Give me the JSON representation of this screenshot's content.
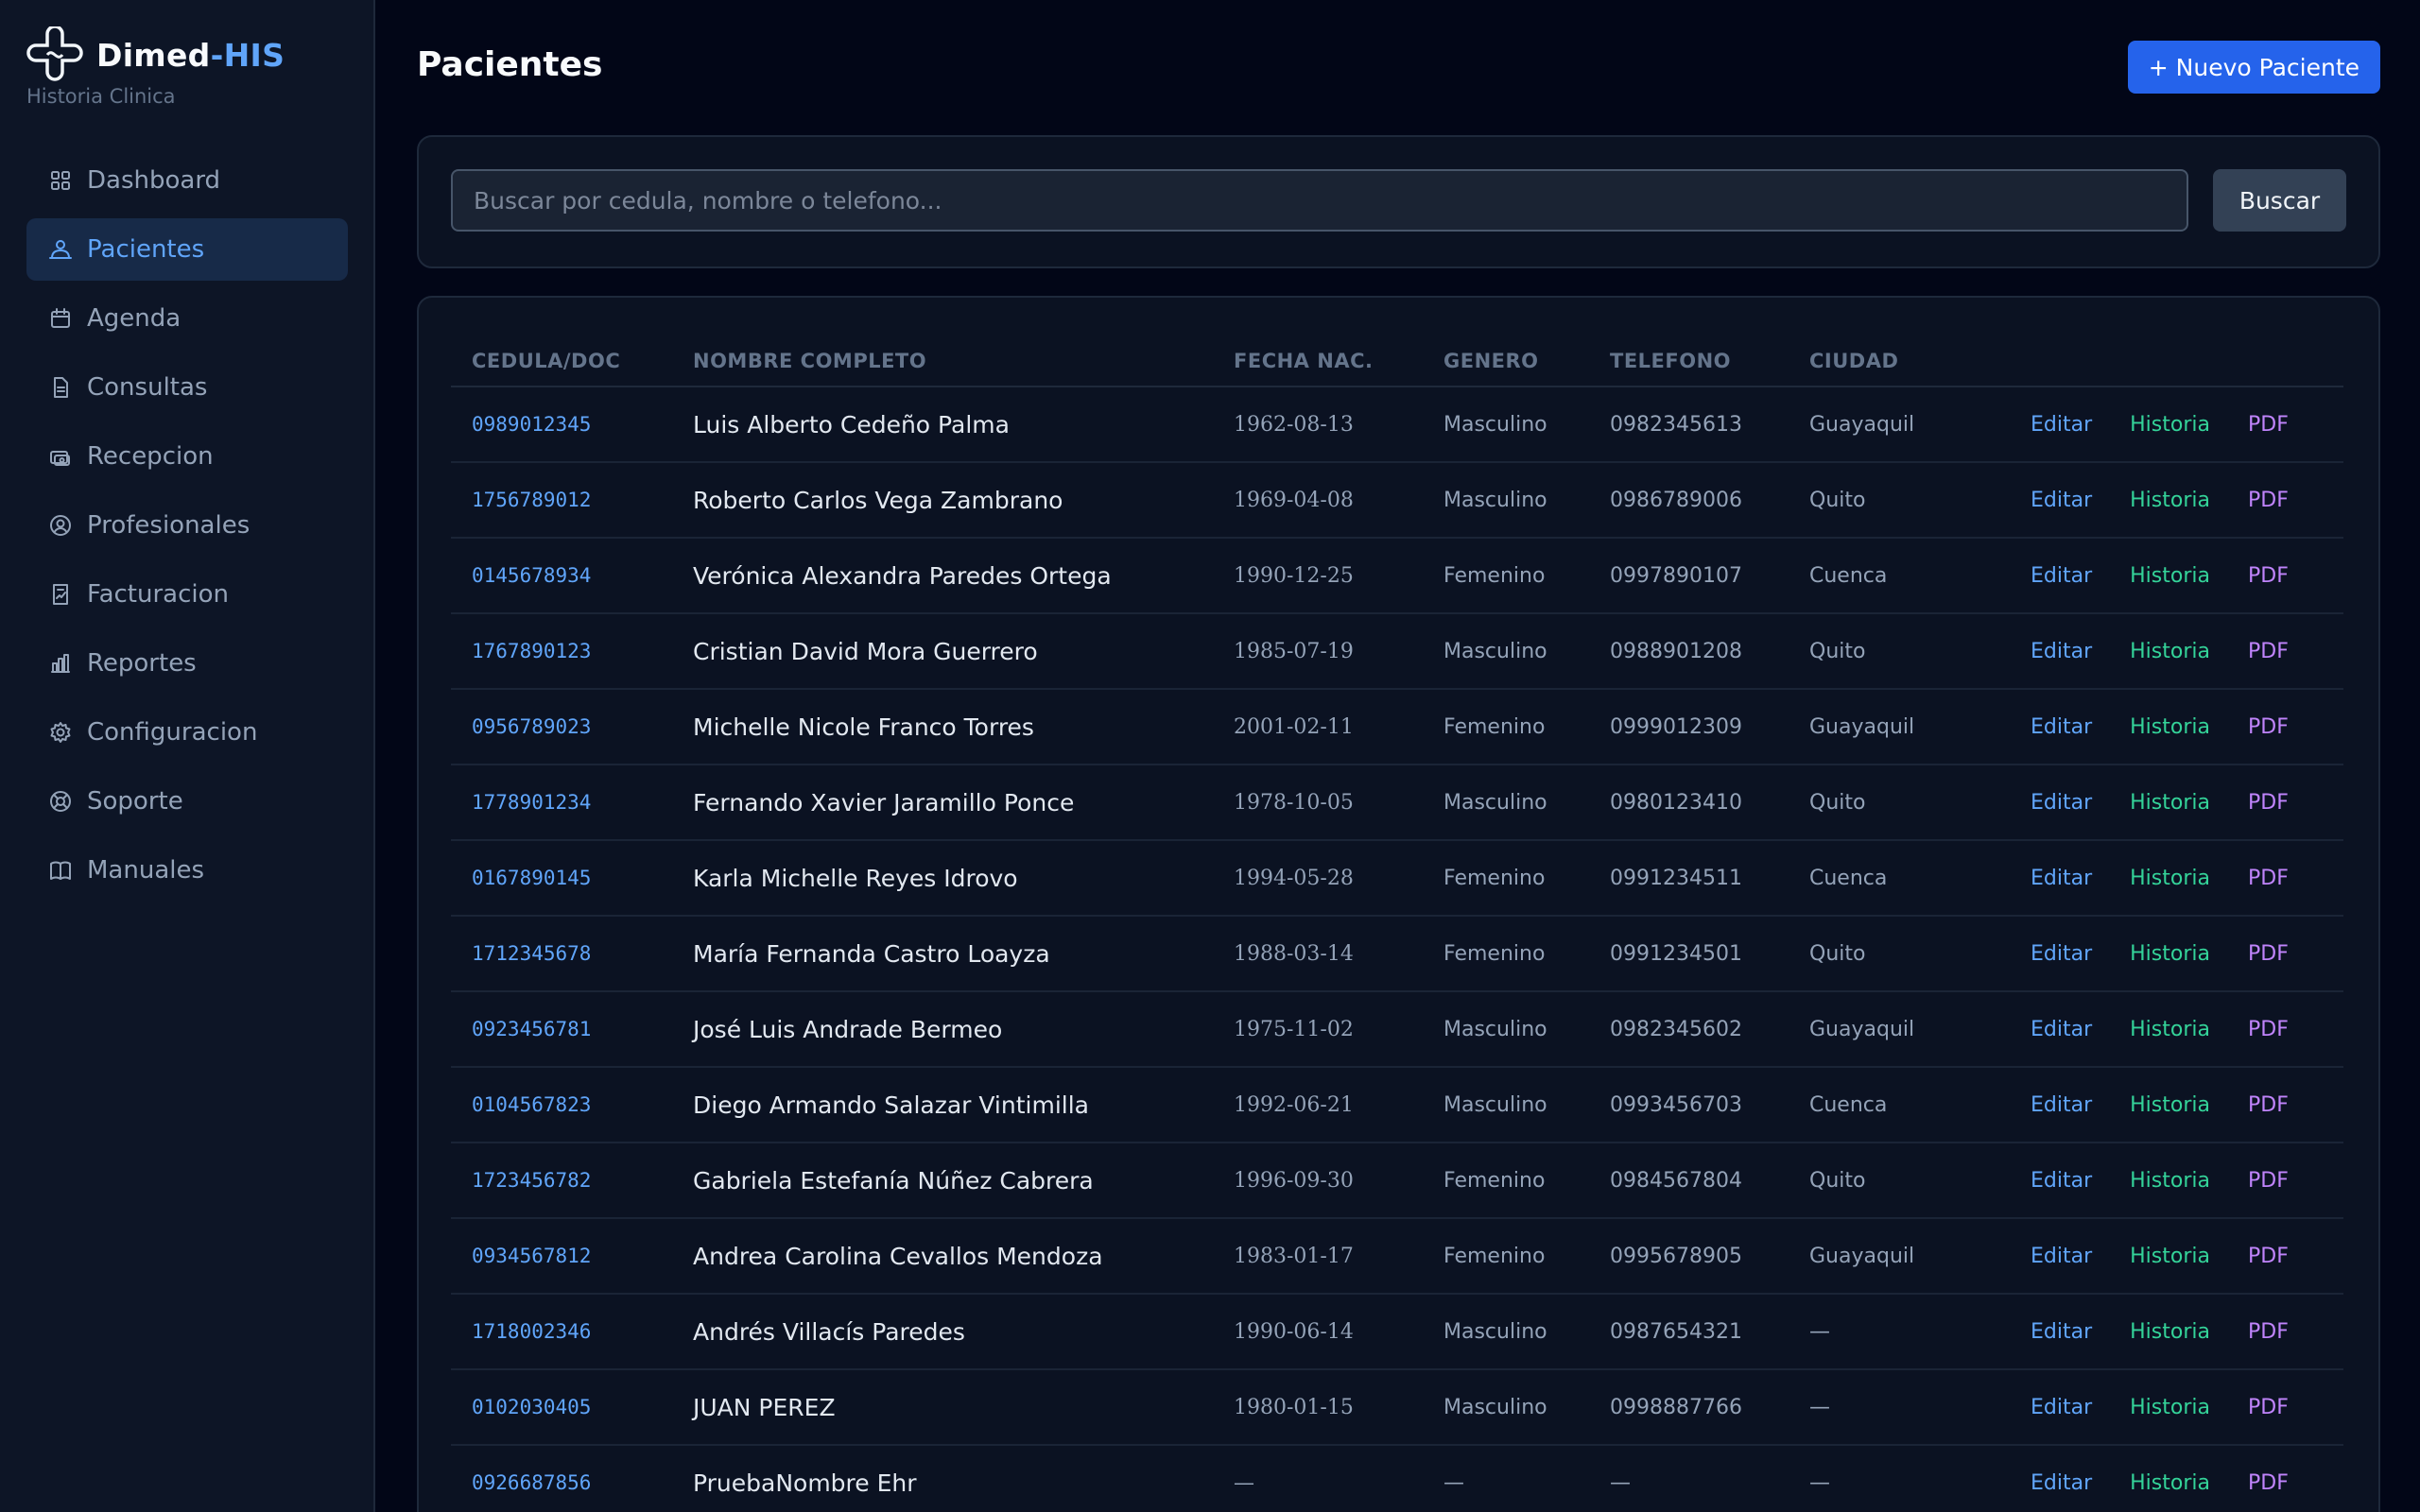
{
  "brand": {
    "name": "Dimed",
    "name_accent": "-HIS",
    "subtitle": "Historia Clinica"
  },
  "sidebar": {
    "items": [
      {
        "label": "Dashboard",
        "icon": "grid-icon",
        "active": false
      },
      {
        "label": "Pacientes",
        "icon": "users-icon",
        "active": true
      },
      {
        "label": "Agenda",
        "icon": "calendar-icon",
        "active": false
      },
      {
        "label": "Consultas",
        "icon": "document-icon",
        "active": false
      },
      {
        "label": "Recepcion",
        "icon": "reception-icon",
        "active": false
      },
      {
        "label": "Profesionales",
        "icon": "user-circle-icon",
        "active": false
      },
      {
        "label": "Facturacion",
        "icon": "invoice-icon",
        "active": false
      },
      {
        "label": "Reportes",
        "icon": "bar-chart-icon",
        "active": false
      },
      {
        "label": "Configuracion",
        "icon": "gear-icon",
        "active": false
      },
      {
        "label": "Soporte",
        "icon": "lifebuoy-icon",
        "active": false
      },
      {
        "label": "Manuales",
        "icon": "book-icon",
        "active": false
      }
    ]
  },
  "header": {
    "title": "Pacientes",
    "new_button": "+ Nuevo Paciente"
  },
  "search": {
    "placeholder": "Buscar por cedula, nombre o telefono...",
    "value": "",
    "button": "Buscar"
  },
  "table": {
    "headers": [
      "CEDULA/DOC",
      "NOMBRE COMPLETO",
      "FECHA NAC.",
      "GENERO",
      "TELEFONO",
      "CIUDAD"
    ],
    "actions": {
      "edit": "Editar",
      "history": "Historia",
      "pdf": "PDF"
    },
    "rows": [
      {
        "cedula": "0989012345",
        "nombre": "Luis Alberto Cedeño Palma",
        "fecha": "1962-08-13",
        "genero": "Masculino",
        "telefono": "0982345613",
        "ciudad": "Guayaquil"
      },
      {
        "cedula": "1756789012",
        "nombre": "Roberto Carlos Vega Zambrano",
        "fecha": "1969-04-08",
        "genero": "Masculino",
        "telefono": "0986789006",
        "ciudad": "Quito"
      },
      {
        "cedula": "0145678934",
        "nombre": "Verónica Alexandra Paredes Ortega",
        "fecha": "1990-12-25",
        "genero": "Femenino",
        "telefono": "0997890107",
        "ciudad": "Cuenca"
      },
      {
        "cedula": "1767890123",
        "nombre": "Cristian David Mora Guerrero",
        "fecha": "1985-07-19",
        "genero": "Masculino",
        "telefono": "0988901208",
        "ciudad": "Quito"
      },
      {
        "cedula": "0956789023",
        "nombre": "Michelle Nicole Franco Torres",
        "fecha": "2001-02-11",
        "genero": "Femenino",
        "telefono": "0999012309",
        "ciudad": "Guayaquil"
      },
      {
        "cedula": "1778901234",
        "nombre": "Fernando Xavier Jaramillo Ponce",
        "fecha": "1978-10-05",
        "genero": "Masculino",
        "telefono": "0980123410",
        "ciudad": "Quito"
      },
      {
        "cedula": "0167890145",
        "nombre": "Karla Michelle Reyes Idrovo",
        "fecha": "1994-05-28",
        "genero": "Femenino",
        "telefono": "0991234511",
        "ciudad": "Cuenca"
      },
      {
        "cedula": "1712345678",
        "nombre": "María Fernanda Castro Loayza",
        "fecha": "1988-03-14",
        "genero": "Femenino",
        "telefono": "0991234501",
        "ciudad": "Quito"
      },
      {
        "cedula": "0923456781",
        "nombre": "José Luis Andrade Bermeo",
        "fecha": "1975-11-02",
        "genero": "Masculino",
        "telefono": "0982345602",
        "ciudad": "Guayaquil"
      },
      {
        "cedula": "0104567823",
        "nombre": "Diego Armando Salazar Vintimilla",
        "fecha": "1992-06-21",
        "genero": "Masculino",
        "telefono": "0993456703",
        "ciudad": "Cuenca"
      },
      {
        "cedula": "1723456782",
        "nombre": "Gabriela Estefanía Núñez Cabrera",
        "fecha": "1996-09-30",
        "genero": "Femenino",
        "telefono": "0984567804",
        "ciudad": "Quito"
      },
      {
        "cedula": "0934567812",
        "nombre": "Andrea Carolina Cevallos Mendoza",
        "fecha": "1983-01-17",
        "genero": "Femenino",
        "telefono": "0995678905",
        "ciudad": "Guayaquil"
      },
      {
        "cedula": "1718002346",
        "nombre": "Andrés Villacís Paredes",
        "fecha": "1990-06-14",
        "genero": "Masculino",
        "telefono": "0987654321",
        "ciudad": "—"
      },
      {
        "cedula": "0102030405",
        "nombre": "JUAN PEREZ",
        "fecha": "1980-01-15",
        "genero": "Masculino",
        "telefono": "0998887766",
        "ciudad": "—"
      },
      {
        "cedula": "0926687856",
        "nombre": "PruebaNombre Ehr",
        "fecha": "—",
        "genero": "—",
        "telefono": "—",
        "ciudad": "—"
      }
    ]
  },
  "colors": {
    "background": "#020617",
    "sidebar": "#0d1526",
    "accent": "#2563eb",
    "link_blue": "#60a5fa",
    "link_green": "#34d399",
    "link_purple": "#c084fc"
  }
}
